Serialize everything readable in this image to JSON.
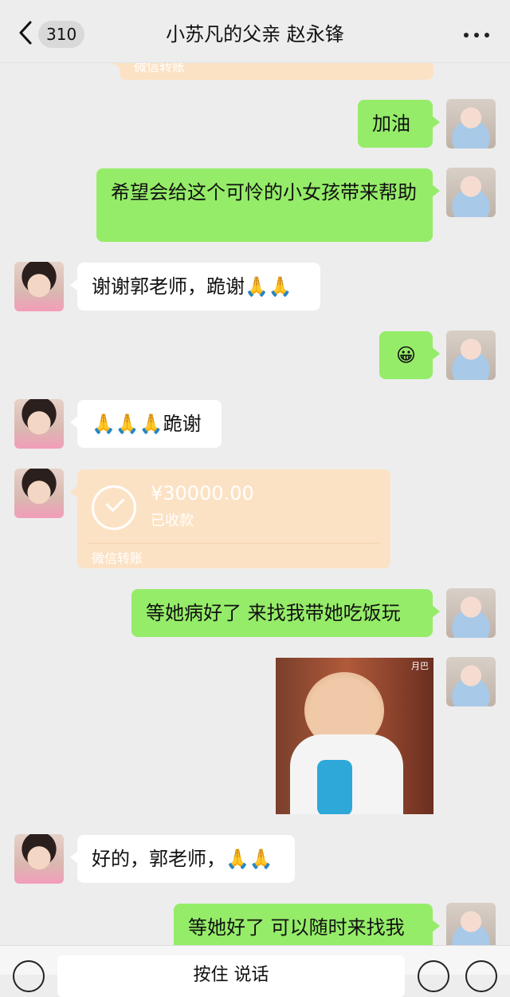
{
  "header": {
    "back_icon": "chevron-left-icon",
    "unread_count": "310",
    "title": "小苏凡的父亲 赵永锋",
    "more_icon": "more-dots-icon"
  },
  "transfer_top": {
    "label": "微信转账"
  },
  "messages": [
    {
      "side": "right",
      "type": "text",
      "text": "加油"
    },
    {
      "side": "right",
      "type": "text",
      "text": "希望会给这个可怜的小女孩带来帮助"
    },
    {
      "side": "left",
      "type": "text",
      "text": "谢谢郭老师，跪谢🙏🙏"
    },
    {
      "side": "right",
      "type": "text",
      "text": "😀"
    },
    {
      "side": "left",
      "type": "text",
      "text": "🙏🙏🙏跪谢"
    },
    {
      "side": "left",
      "type": "transfer",
      "amount": "¥30000.00",
      "status": "已收款",
      "label": "微信转账"
    },
    {
      "side": "right",
      "type": "text",
      "text": "等她病好了 来找我带她吃饭玩"
    },
    {
      "side": "right",
      "type": "sticker",
      "watermark": "月巴"
    },
    {
      "side": "left",
      "type": "text",
      "text": "好的，郭老师，🙏🙏"
    },
    {
      "side": "right",
      "type": "text",
      "text": "等她好了 可以随时来找我"
    }
  ],
  "input_bar": {
    "text": "按住 说话",
    "voice_icon": "voice-icon",
    "emoji_icon": "emoji-icon",
    "plus_icon": "plus-icon"
  },
  "colors": {
    "background": "#ededed",
    "sent_bubble": "#95ec69",
    "received_bubble": "#ffffff",
    "transfer_bubble": "#fce2c4"
  }
}
